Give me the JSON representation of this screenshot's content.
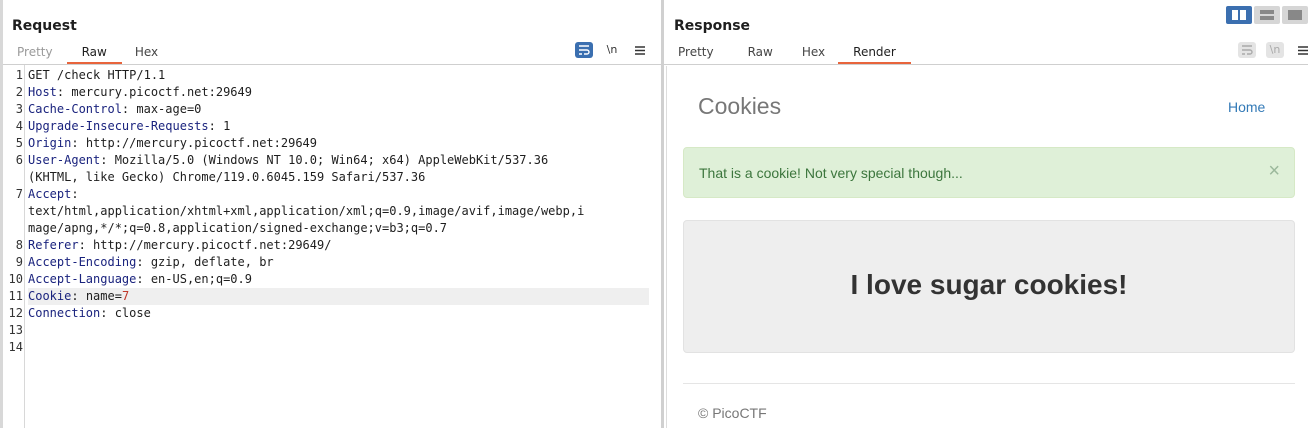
{
  "request": {
    "title": "Request",
    "tabs": [
      {
        "label": "Pretty"
      },
      {
        "label": "Raw"
      },
      {
        "label": "Hex"
      }
    ],
    "active_tab": "Raw",
    "tools": {
      "wrap_icon": "wrap-lines-icon",
      "newline_label": "\\n",
      "menu_icon": "hamburger-menu-icon"
    },
    "lines": [
      {
        "num": "1",
        "key": "",
        "value": "GET /check HTTP/1.1"
      },
      {
        "num": "2",
        "key": "Host",
        "value": " mercury.picoctf.net:29649"
      },
      {
        "num": "3",
        "key": "Cache-Control",
        "value": " max-age=0"
      },
      {
        "num": "4",
        "key": "Upgrade-Insecure-Requests",
        "value": " 1"
      },
      {
        "num": "5",
        "key": "Origin",
        "value": " http://mercury.picoctf.net:29649"
      },
      {
        "num": "6",
        "key": "User-Agent",
        "value": " Mozilla/5.0 (Windows NT 10.0; Win64; x64) AppleWebKit/537.36"
      },
      {
        "num": "",
        "key": "",
        "value": "(KHTML, like Gecko) Chrome/119.0.6045.159 Safari/537.36"
      },
      {
        "num": "7",
        "key": "Accept",
        "value": ""
      },
      {
        "num": "",
        "key": "",
        "value": "text/html,application/xhtml+xml,application/xml;q=0.9,image/avif,image/webp,i"
      },
      {
        "num": "",
        "key": "",
        "value": "mage/apng,*/*;q=0.8,application/signed-exchange;v=b3;q=0.7"
      },
      {
        "num": "8",
        "key": "Referer",
        "value": " http://mercury.picoctf.net:29649/"
      },
      {
        "num": "9",
        "key": "Accept-Encoding",
        "value": " gzip, deflate, br"
      },
      {
        "num": "10",
        "key": "Accept-Language",
        "value": " en-US,en;q=0.9"
      },
      {
        "num": "11",
        "key": "Cookie",
        "value": " name=",
        "cookie_value": "7",
        "highlight": true
      },
      {
        "num": "12",
        "key": "Connection",
        "value": " close"
      },
      {
        "num": "13",
        "key": "",
        "value": ""
      },
      {
        "num": "14",
        "key": "",
        "value": ""
      }
    ]
  },
  "response": {
    "title": "Response",
    "tabs": [
      {
        "label": "Pretty"
      },
      {
        "label": "Raw"
      },
      {
        "label": "Hex"
      },
      {
        "label": "Render"
      }
    ],
    "active_tab": "Render",
    "tools": {
      "newline_label": "\\n"
    },
    "render": {
      "site_title": "Cookies",
      "home_link": "Home",
      "alert_text": "That is a cookie! Not very special though...",
      "alert_close": "×",
      "jumbotron_text": "I love sugar cookies!",
      "footer": "© PicoCTF"
    }
  },
  "colors": {
    "accent": "#e8643c",
    "active_tool": "#3b6fb0",
    "alert_bg": "#dff0d8",
    "alert_text": "#3c763d",
    "link": "#337ab7"
  }
}
